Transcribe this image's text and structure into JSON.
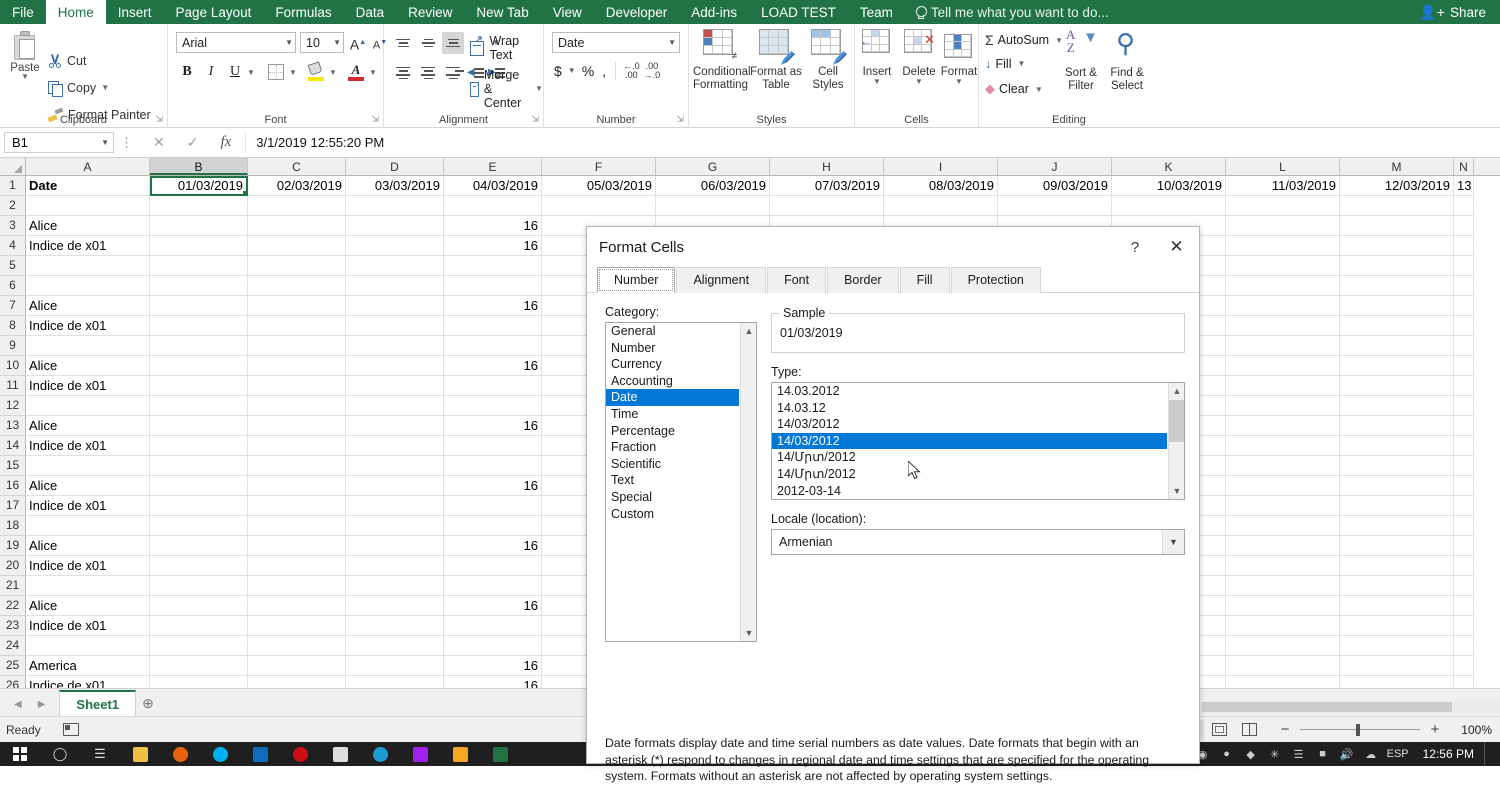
{
  "ribbon": {
    "tabs": [
      {
        "label": "File",
        "active": false
      },
      {
        "label": "Home",
        "active": true
      },
      {
        "label": "Insert",
        "active": false
      },
      {
        "label": "Page Layout",
        "active": false
      },
      {
        "label": "Formulas",
        "active": false
      },
      {
        "label": "Data",
        "active": false
      },
      {
        "label": "Review",
        "active": false
      },
      {
        "label": "New Tab",
        "active": false
      },
      {
        "label": "View",
        "active": false
      },
      {
        "label": "Developer",
        "active": false
      },
      {
        "label": "Add-ins",
        "active": false
      },
      {
        "label": "LOAD TEST",
        "active": false
      },
      {
        "label": "Team",
        "active": false
      }
    ],
    "tellme_placeholder": "Tell me what you want to do...",
    "share_label": "Share",
    "groups": {
      "clipboard": {
        "label": "Clipboard",
        "paste": "Paste",
        "cut": "Cut",
        "copy": "Copy",
        "format_painter": "Format Painter"
      },
      "font": {
        "label": "Font",
        "font_name": "Arial",
        "font_size": "10",
        "bold": "B",
        "italic": "I",
        "underline": "U",
        "grow_font": "A",
        "shrink_font": "A"
      },
      "alignment": {
        "label": "Alignment",
        "wrap_text": "Wrap Text",
        "merge_center": "Merge & Center"
      },
      "number": {
        "label": "Number",
        "format": "Date",
        "currency": "$",
        "percent": "%",
        "comma": ",",
        "increase_decimal": ".00",
        "decrease_decimal": ".00"
      },
      "styles": {
        "label": "Styles",
        "conditional_formatting": "Conditional\nFormatting",
        "conditional_formatting_l1": "Conditional",
        "conditional_formatting_l2": "Formatting",
        "format_as_table_l1": "Format as",
        "format_as_table_l2": "Table",
        "cell_styles_l1": "Cell",
        "cell_styles_l2": "Styles"
      },
      "cells": {
        "label": "Cells",
        "insert": "Insert",
        "delete": "Delete",
        "format": "Format"
      },
      "editing": {
        "label": "Editing",
        "autosum": "AutoSum",
        "fill": "Fill",
        "clear": "Clear",
        "sort_filter_l1": "Sort &",
        "sort_filter_l2": "Filter",
        "find_select_l1": "Find &",
        "find_select_l2": "Select"
      }
    }
  },
  "formula_bar": {
    "name_box": "B1",
    "value": "3/1/2019  12:55:20 PM"
  },
  "grid": {
    "columns": [
      "A",
      "B",
      "C",
      "D",
      "E",
      "F",
      "G",
      "H",
      "I",
      "J",
      "K",
      "L",
      "M",
      "N"
    ],
    "selected_column": "B",
    "active_cell": "B1",
    "rows": [
      {
        "num": "1",
        "cells": [
          "Date",
          "01/03/2019",
          "02/03/2019",
          "03/03/2019",
          "04/03/2019",
          "05/03/2019",
          "06/03/2019",
          "07/03/2019",
          "08/03/2019",
          "09/03/2019",
          "10/03/2019",
          "11/03/2019",
          "12/03/2019",
          "13"
        ]
      },
      {
        "num": "2",
        "cells": [
          "",
          "",
          "",
          "",
          "",
          "",
          "",
          "",
          "",
          "",
          "",
          "",
          "",
          ""
        ]
      },
      {
        "num": "3",
        "cells": [
          "Alice",
          "",
          "",
          "",
          "16",
          "",
          "",
          "",
          "",
          "",
          "",
          "",
          "",
          ""
        ]
      },
      {
        "num": "4",
        "cells": [
          "Indice de x01",
          "",
          "",
          "",
          "16",
          "",
          "",
          "",
          "",
          "",
          "",
          "",
          "",
          ""
        ]
      },
      {
        "num": "5",
        "cells": [
          "",
          "",
          "",
          "",
          "",
          "",
          "",
          "",
          "",
          "",
          "",
          "",
          "",
          ""
        ]
      },
      {
        "num": "6",
        "cells": [
          "",
          "",
          "",
          "",
          "",
          "",
          "",
          "",
          "",
          "",
          "",
          "",
          "",
          ""
        ]
      },
      {
        "num": "7",
        "cells": [
          "Alice",
          "",
          "",
          "",
          "16",
          "",
          "",
          "",
          "",
          "",
          "",
          "",
          "",
          ""
        ]
      },
      {
        "num": "8",
        "cells": [
          "Indice de x01",
          "",
          "",
          "",
          "",
          "",
          "",
          "",
          "",
          "",
          "",
          "",
          "",
          ""
        ]
      },
      {
        "num": "9",
        "cells": [
          "",
          "",
          "",
          "",
          "",
          "",
          "",
          "",
          "",
          "",
          "",
          "",
          "",
          ""
        ]
      },
      {
        "num": "10",
        "cells": [
          "Alice",
          "",
          "",
          "",
          "16",
          "",
          "",
          "",
          "",
          "",
          "",
          "",
          "",
          ""
        ]
      },
      {
        "num": "11",
        "cells": [
          "Indice de x01",
          "",
          "",
          "",
          "",
          "",
          "",
          "",
          "",
          "",
          "",
          "",
          "",
          ""
        ]
      },
      {
        "num": "12",
        "cells": [
          "",
          "",
          "",
          "",
          "",
          "",
          "",
          "",
          "",
          "",
          "",
          "",
          "",
          ""
        ]
      },
      {
        "num": "13",
        "cells": [
          "Alice",
          "",
          "",
          "",
          "16",
          "",
          "",
          "",
          "",
          "",
          "",
          "",
          "",
          ""
        ]
      },
      {
        "num": "14",
        "cells": [
          "Indice de x01",
          "",
          "",
          "",
          "",
          "",
          "",
          "",
          "",
          "",
          "",
          "",
          "",
          ""
        ]
      },
      {
        "num": "15",
        "cells": [
          "",
          "",
          "",
          "",
          "",
          "",
          "",
          "",
          "",
          "",
          "",
          "",
          "",
          ""
        ]
      },
      {
        "num": "16",
        "cells": [
          "Alice",
          "",
          "",
          "",
          "16",
          "",
          "",
          "",
          "",
          "",
          "",
          "",
          "",
          ""
        ]
      },
      {
        "num": "17",
        "cells": [
          "Indice de x01",
          "",
          "",
          "",
          "",
          "",
          "",
          "",
          "",
          "",
          "",
          "",
          "",
          ""
        ]
      },
      {
        "num": "18",
        "cells": [
          "",
          "",
          "",
          "",
          "",
          "",
          "",
          "",
          "",
          "",
          "",
          "",
          "",
          ""
        ]
      },
      {
        "num": "19",
        "cells": [
          "Alice",
          "",
          "",
          "",
          "16",
          "",
          "",
          "",
          "",
          "",
          "",
          "",
          "",
          ""
        ]
      },
      {
        "num": "20",
        "cells": [
          "Indice de x01",
          "",
          "",
          "",
          "",
          "",
          "",
          "",
          "",
          "",
          "",
          "",
          "",
          ""
        ]
      },
      {
        "num": "21",
        "cells": [
          "",
          "",
          "",
          "",
          "",
          "",
          "",
          "",
          "",
          "",
          "",
          "",
          "",
          ""
        ]
      },
      {
        "num": "22",
        "cells": [
          "Alice",
          "",
          "",
          "",
          "16",
          "",
          "",
          "",
          "",
          "",
          "",
          "",
          "",
          ""
        ]
      },
      {
        "num": "23",
        "cells": [
          "Indice de x01",
          "",
          "",
          "",
          "",
          "",
          "",
          "",
          "",
          "",
          "",
          "",
          "",
          ""
        ]
      },
      {
        "num": "24",
        "cells": [
          "",
          "",
          "",
          "",
          "",
          "",
          "",
          "",
          "",
          "",
          "",
          "",
          "",
          ""
        ]
      },
      {
        "num": "25",
        "cells": [
          "America",
          "",
          "",
          "",
          "16",
          "",
          "",
          "",
          "",
          "",
          "",
          "",
          "",
          ""
        ]
      },
      {
        "num": "26",
        "cells": [
          "Indice de x01",
          "",
          "",
          "",
          "16",
          "",
          "",
          "",
          "",
          "",
          "",
          "",
          "",
          ""
        ]
      }
    ]
  },
  "sheet_bar": {
    "sheet_name": "Sheet1",
    "add_sheet": "+"
  },
  "status_bar": {
    "status": "Ready",
    "zoom": "100%"
  },
  "taskbar": {
    "clock": "12:56 PM",
    "language": "ESP"
  },
  "dialog": {
    "title": "Format Cells",
    "help": "?",
    "close": "✕",
    "tabs": [
      {
        "label": "Number",
        "active": true
      },
      {
        "label": "Alignment",
        "active": false
      },
      {
        "label": "Font",
        "active": false
      },
      {
        "label": "Border",
        "active": false
      },
      {
        "label": "Fill",
        "active": false
      },
      {
        "label": "Protection",
        "active": false
      }
    ],
    "category_label": "Category:",
    "categories": [
      {
        "label": "General",
        "selected": false
      },
      {
        "label": "Number",
        "selected": false
      },
      {
        "label": "Currency",
        "selected": false
      },
      {
        "label": "Accounting",
        "selected": false
      },
      {
        "label": "Date",
        "selected": true
      },
      {
        "label": "Time",
        "selected": false
      },
      {
        "label": "Percentage",
        "selected": false
      },
      {
        "label": "Fraction",
        "selected": false
      },
      {
        "label": "Scientific",
        "selected": false
      },
      {
        "label": "Text",
        "selected": false
      },
      {
        "label": "Special",
        "selected": false
      },
      {
        "label": "Custom",
        "selected": false
      }
    ],
    "sample_label": "Sample",
    "sample_value": "01/03/2019",
    "type_label": "Type:",
    "types": [
      {
        "label": "14.03.2012",
        "selected": false
      },
      {
        "label": "14.03.12",
        "selected": false
      },
      {
        "label": "14/03/2012",
        "selected": false
      },
      {
        "label": "14/03/2012",
        "selected": true
      },
      {
        "label": "14/Մրտ/2012",
        "selected": false
      },
      {
        "label": "14/Մրտ/2012",
        "selected": false
      },
      {
        "label": "2012-03-14",
        "selected": false
      }
    ],
    "locale_label": "Locale (location):",
    "locale_value": "Armenian",
    "description": "Date formats display date and time serial numbers as date values.  Date formats that begin with an asterisk (*) respond to changes in regional date and time settings that are specified for the operating system. Formats without an asterisk are not affected by operating system settings."
  },
  "colors": {
    "excel_green": "#217346",
    "selection_blue": "#0078d7",
    "accent_blue": "#3b6fa8"
  }
}
